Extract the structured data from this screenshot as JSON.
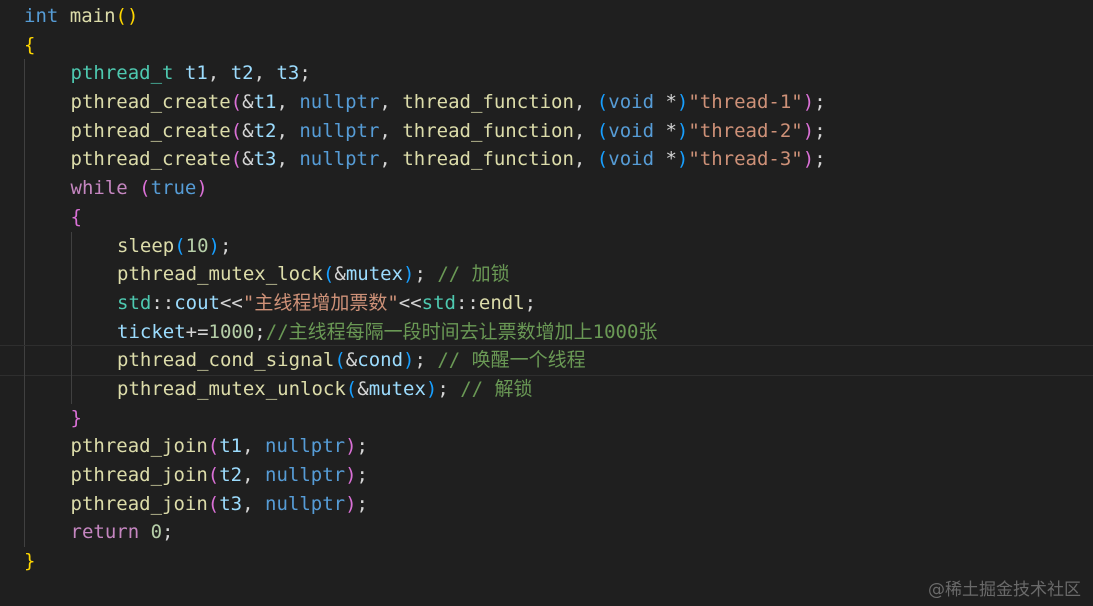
{
  "editor": {
    "theme_colors": {
      "background": "#1f1f1f",
      "keyword_blue": "#569cd6",
      "keyword_purple": "#c586c0",
      "type": "#4ec9b0",
      "function": "#dcdcaa",
      "variable": "#9cdcfe",
      "string": "#ce9178",
      "number": "#b5cea8",
      "comment": "#6a9955",
      "bracket_gold": "#ffd700",
      "bracket_orchid": "#da70d6",
      "bracket_blue": "#179fff",
      "plain": "#d4d4d4"
    },
    "lines": [
      {
        "indent": 0,
        "current": false,
        "tokens": [
          {
            "t": "kw-blue",
            "v": "int"
          },
          {
            "t": "punc",
            "v": " "
          },
          {
            "t": "fn",
            "v": "main"
          },
          {
            "t": "p1",
            "v": "("
          },
          {
            "t": "p1",
            "v": ")"
          }
        ]
      },
      {
        "indent": 0,
        "current": false,
        "tokens": [
          {
            "t": "p1",
            "v": "{"
          }
        ]
      },
      {
        "indent": 1,
        "current": false,
        "tokens": [
          {
            "t": "type",
            "v": "pthread_t"
          },
          {
            "t": "punc",
            "v": " "
          },
          {
            "t": "var",
            "v": "t1"
          },
          {
            "t": "punc",
            "v": ", "
          },
          {
            "t": "var",
            "v": "t2"
          },
          {
            "t": "punc",
            "v": ", "
          },
          {
            "t": "var",
            "v": "t3"
          },
          {
            "t": "punc",
            "v": ";"
          }
        ]
      },
      {
        "indent": 1,
        "current": false,
        "tokens": [
          {
            "t": "fn",
            "v": "pthread_create"
          },
          {
            "t": "p2",
            "v": "("
          },
          {
            "t": "punc",
            "v": "&"
          },
          {
            "t": "var",
            "v": "t1"
          },
          {
            "t": "punc",
            "v": ", "
          },
          {
            "t": "kw-blue",
            "v": "nullptr"
          },
          {
            "t": "punc",
            "v": ", "
          },
          {
            "t": "fn",
            "v": "thread_function"
          },
          {
            "t": "punc",
            "v": ", "
          },
          {
            "t": "p3",
            "v": "("
          },
          {
            "t": "kw-blue",
            "v": "void"
          },
          {
            "t": "punc",
            "v": " *"
          },
          {
            "t": "p3",
            "v": ")"
          },
          {
            "t": "str",
            "v": "\"thread-1\""
          },
          {
            "t": "p2",
            "v": ")"
          },
          {
            "t": "punc",
            "v": ";"
          }
        ]
      },
      {
        "indent": 1,
        "current": false,
        "tokens": [
          {
            "t": "fn",
            "v": "pthread_create"
          },
          {
            "t": "p2",
            "v": "("
          },
          {
            "t": "punc",
            "v": "&"
          },
          {
            "t": "var",
            "v": "t2"
          },
          {
            "t": "punc",
            "v": ", "
          },
          {
            "t": "kw-blue",
            "v": "nullptr"
          },
          {
            "t": "punc",
            "v": ", "
          },
          {
            "t": "fn",
            "v": "thread_function"
          },
          {
            "t": "punc",
            "v": ", "
          },
          {
            "t": "p3",
            "v": "("
          },
          {
            "t": "kw-blue",
            "v": "void"
          },
          {
            "t": "punc",
            "v": " *"
          },
          {
            "t": "p3",
            "v": ")"
          },
          {
            "t": "str",
            "v": "\"thread-2\""
          },
          {
            "t": "p2",
            "v": ")"
          },
          {
            "t": "punc",
            "v": ";"
          }
        ]
      },
      {
        "indent": 1,
        "current": false,
        "tokens": [
          {
            "t": "fn",
            "v": "pthread_create"
          },
          {
            "t": "p2",
            "v": "("
          },
          {
            "t": "punc",
            "v": "&"
          },
          {
            "t": "var",
            "v": "t3"
          },
          {
            "t": "punc",
            "v": ", "
          },
          {
            "t": "kw-blue",
            "v": "nullptr"
          },
          {
            "t": "punc",
            "v": ", "
          },
          {
            "t": "fn",
            "v": "thread_function"
          },
          {
            "t": "punc",
            "v": ", "
          },
          {
            "t": "p3",
            "v": "("
          },
          {
            "t": "kw-blue",
            "v": "void"
          },
          {
            "t": "punc",
            "v": " *"
          },
          {
            "t": "p3",
            "v": ")"
          },
          {
            "t": "str",
            "v": "\"thread-3\""
          },
          {
            "t": "p2",
            "v": ")"
          },
          {
            "t": "punc",
            "v": ";"
          }
        ]
      },
      {
        "indent": 1,
        "current": false,
        "tokens": [
          {
            "t": "kw-purple",
            "v": "while"
          },
          {
            "t": "punc",
            "v": " "
          },
          {
            "t": "p2",
            "v": "("
          },
          {
            "t": "kw-blue",
            "v": "true"
          },
          {
            "t": "p2",
            "v": ")"
          }
        ]
      },
      {
        "indent": 1,
        "current": false,
        "tokens": [
          {
            "t": "p2",
            "v": "{"
          }
        ]
      },
      {
        "indent": 2,
        "current": false,
        "tokens": [
          {
            "t": "fn",
            "v": "sleep"
          },
          {
            "t": "p3",
            "v": "("
          },
          {
            "t": "num",
            "v": "10"
          },
          {
            "t": "p3",
            "v": ")"
          },
          {
            "t": "punc",
            "v": ";"
          }
        ]
      },
      {
        "indent": 2,
        "current": false,
        "tokens": [
          {
            "t": "fn",
            "v": "pthread_mutex_lock"
          },
          {
            "t": "p3",
            "v": "("
          },
          {
            "t": "punc",
            "v": "&"
          },
          {
            "t": "var",
            "v": "mutex"
          },
          {
            "t": "p3",
            "v": ")"
          },
          {
            "t": "punc",
            "v": "; "
          },
          {
            "t": "cmt",
            "v": "// 加锁"
          }
        ]
      },
      {
        "indent": 2,
        "current": false,
        "tokens": [
          {
            "t": "type",
            "v": "std"
          },
          {
            "t": "punc",
            "v": "::"
          },
          {
            "t": "var",
            "v": "cout"
          },
          {
            "t": "punc",
            "v": "<<"
          },
          {
            "t": "str",
            "v": "\"主线程增加票数\""
          },
          {
            "t": "punc",
            "v": "<<"
          },
          {
            "t": "type",
            "v": "std"
          },
          {
            "t": "punc",
            "v": "::"
          },
          {
            "t": "fn",
            "v": "endl"
          },
          {
            "t": "punc",
            "v": ";"
          }
        ]
      },
      {
        "indent": 2,
        "current": false,
        "tokens": [
          {
            "t": "var",
            "v": "ticket"
          },
          {
            "t": "punc",
            "v": "+="
          },
          {
            "t": "num",
            "v": "1000"
          },
          {
            "t": "punc",
            "v": ";"
          },
          {
            "t": "cmt",
            "v": "//主线程每隔一段时间去让票数增加上1000张"
          }
        ]
      },
      {
        "indent": 2,
        "current": true,
        "tokens": [
          {
            "t": "fn",
            "v": "pthread_cond_signal"
          },
          {
            "t": "p3",
            "v": "("
          },
          {
            "t": "punc",
            "v": "&"
          },
          {
            "t": "var",
            "v": "cond"
          },
          {
            "t": "p3",
            "v": ")"
          },
          {
            "t": "punc",
            "v": "; "
          },
          {
            "t": "cmt",
            "v": "// 唤醒一个线程"
          }
        ]
      },
      {
        "indent": 2,
        "current": false,
        "tokens": [
          {
            "t": "fn",
            "v": "pthread_mutex_unlock"
          },
          {
            "t": "p3",
            "v": "("
          },
          {
            "t": "punc",
            "v": "&"
          },
          {
            "t": "var",
            "v": "mutex"
          },
          {
            "t": "p3",
            "v": ")"
          },
          {
            "t": "punc",
            "v": "; "
          },
          {
            "t": "cmt",
            "v": "// 解锁"
          }
        ]
      },
      {
        "indent": 1,
        "current": false,
        "tokens": [
          {
            "t": "p2",
            "v": "}"
          }
        ]
      },
      {
        "indent": 1,
        "current": false,
        "tokens": [
          {
            "t": "fn",
            "v": "pthread_join"
          },
          {
            "t": "p2",
            "v": "("
          },
          {
            "t": "var",
            "v": "t1"
          },
          {
            "t": "punc",
            "v": ", "
          },
          {
            "t": "kw-blue",
            "v": "nullptr"
          },
          {
            "t": "p2",
            "v": ")"
          },
          {
            "t": "punc",
            "v": ";"
          }
        ]
      },
      {
        "indent": 1,
        "current": false,
        "tokens": [
          {
            "t": "fn",
            "v": "pthread_join"
          },
          {
            "t": "p2",
            "v": "("
          },
          {
            "t": "var",
            "v": "t2"
          },
          {
            "t": "punc",
            "v": ", "
          },
          {
            "t": "kw-blue",
            "v": "nullptr"
          },
          {
            "t": "p2",
            "v": ")"
          },
          {
            "t": "punc",
            "v": ";"
          }
        ]
      },
      {
        "indent": 1,
        "current": false,
        "tokens": [
          {
            "t": "fn",
            "v": "pthread_join"
          },
          {
            "t": "p2",
            "v": "("
          },
          {
            "t": "var",
            "v": "t3"
          },
          {
            "t": "punc",
            "v": ", "
          },
          {
            "t": "kw-blue",
            "v": "nullptr"
          },
          {
            "t": "p2",
            "v": ")"
          },
          {
            "t": "punc",
            "v": ";"
          }
        ]
      },
      {
        "indent": 1,
        "current": false,
        "tokens": [
          {
            "t": "kw-purple",
            "v": "return"
          },
          {
            "t": "punc",
            "v": " "
          },
          {
            "t": "num",
            "v": "0"
          },
          {
            "t": "punc",
            "v": ";"
          }
        ]
      },
      {
        "indent": 0,
        "current": false,
        "tokens": [
          {
            "t": "p1",
            "v": "}"
          }
        ]
      }
    ]
  },
  "watermark": {
    "text": "@稀土掘金技术社区"
  }
}
